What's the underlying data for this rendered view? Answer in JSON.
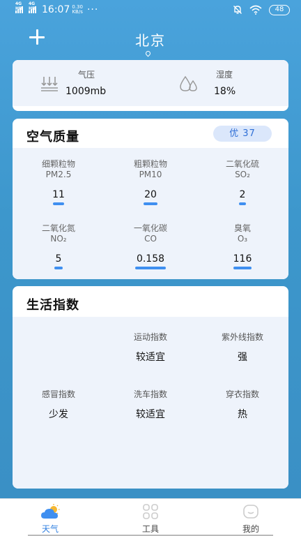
{
  "status_bar": {
    "signal1": "4G HD",
    "signal2": "4G HD",
    "time": "16:07",
    "net_speed_value": "0.30",
    "net_speed_unit": "KB/s",
    "more": "···",
    "battery": "48"
  },
  "header": {
    "city": "北京"
  },
  "conditions": {
    "pressure_label": "气压",
    "pressure_value": "1009mb",
    "humidity_label": "湿度",
    "humidity_value": "18%"
  },
  "air_quality": {
    "title": "空气质量",
    "badge": "优  37",
    "items": [
      {
        "name": "细颗粒物",
        "sub": "PM2.5",
        "value": "11",
        "level": 0.12
      },
      {
        "name": "粗颗粒物",
        "sub": "PM10",
        "value": "20",
        "level": 0.14
      },
      {
        "name": "二氧化硫",
        "sub": "SO₂",
        "value": "2",
        "level": 0.07
      },
      {
        "name": "二氧化氮",
        "sub": "NO₂",
        "value": "5",
        "level": 0.08
      },
      {
        "name": "一氧化碳",
        "sub": "CO",
        "value": "0.158",
        "level": 0.31
      },
      {
        "name": "臭氧",
        "sub": "O₃",
        "value": "116",
        "level": 0.18
      }
    ]
  },
  "life_index": {
    "title": "生活指数",
    "items": [
      {
        "name": "运动指数",
        "value": "较适宜"
      },
      {
        "name": "紫外线指数",
        "value": "强"
      },
      {
        "name": "感冒指数",
        "value": "少发"
      },
      {
        "name": "洗车指数",
        "value": "较适宜"
      },
      {
        "name": "穿衣指数",
        "value": "热"
      }
    ]
  },
  "nav": {
    "tabs": [
      {
        "label": "天气",
        "icon": "cloud-sun-icon",
        "active": true
      },
      {
        "label": "工具",
        "icon": "grid-icon",
        "active": false
      },
      {
        "label": "我的",
        "icon": "face-icon",
        "active": false
      }
    ],
    "active_color": "#2f7fe0"
  }
}
